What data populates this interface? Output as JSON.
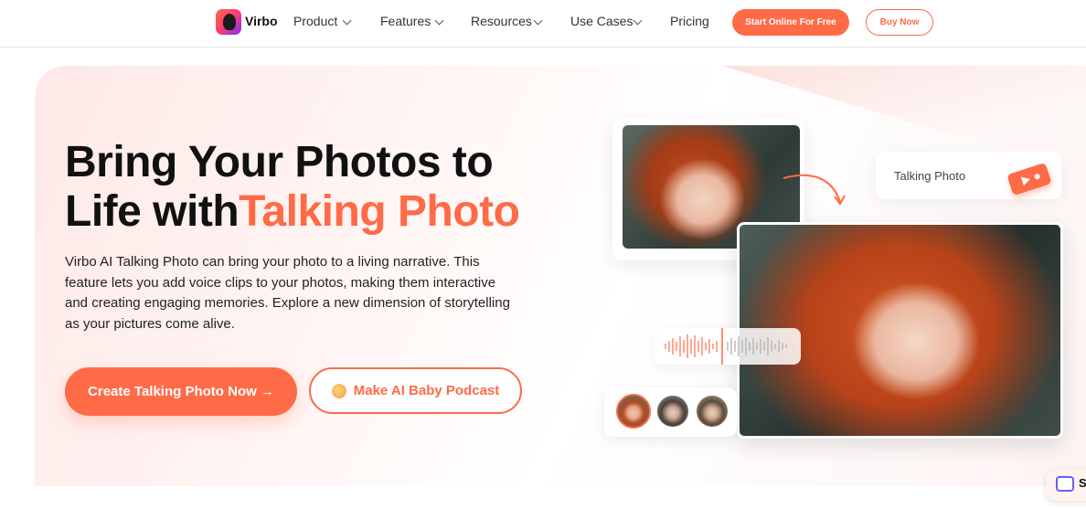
{
  "header": {
    "brand": "Virbo",
    "nav": [
      {
        "label": "Product"
      },
      {
        "label": "Features"
      },
      {
        "label": "Resources"
      },
      {
        "label": "Use Cases"
      },
      {
        "label": "Pricing"
      }
    ],
    "start_button": "Start Online For Free",
    "buy_button": "Buy Now"
  },
  "hero": {
    "title_line1": "Bring Your Photos to",
    "title_line2_prefix": "Life with",
    "title_line2_highlight": "Talking Photo",
    "description": "Virbo AI Talking Photo can bring your photo to a living narrative. This feature lets you add voice clips to your photos, making them interactive and creating engaging memories. Explore a new dimension of storytelling as your pictures come alive.",
    "cta_primary": "Create Talking Photo Now →",
    "cta_secondary": "Make AI Baby Podcast"
  },
  "visual": {
    "feature_label": "Talking Photo"
  },
  "chat_widget": {
    "label": "S"
  },
  "colors": {
    "accent": "#ff6a47",
    "text": "#111111"
  }
}
